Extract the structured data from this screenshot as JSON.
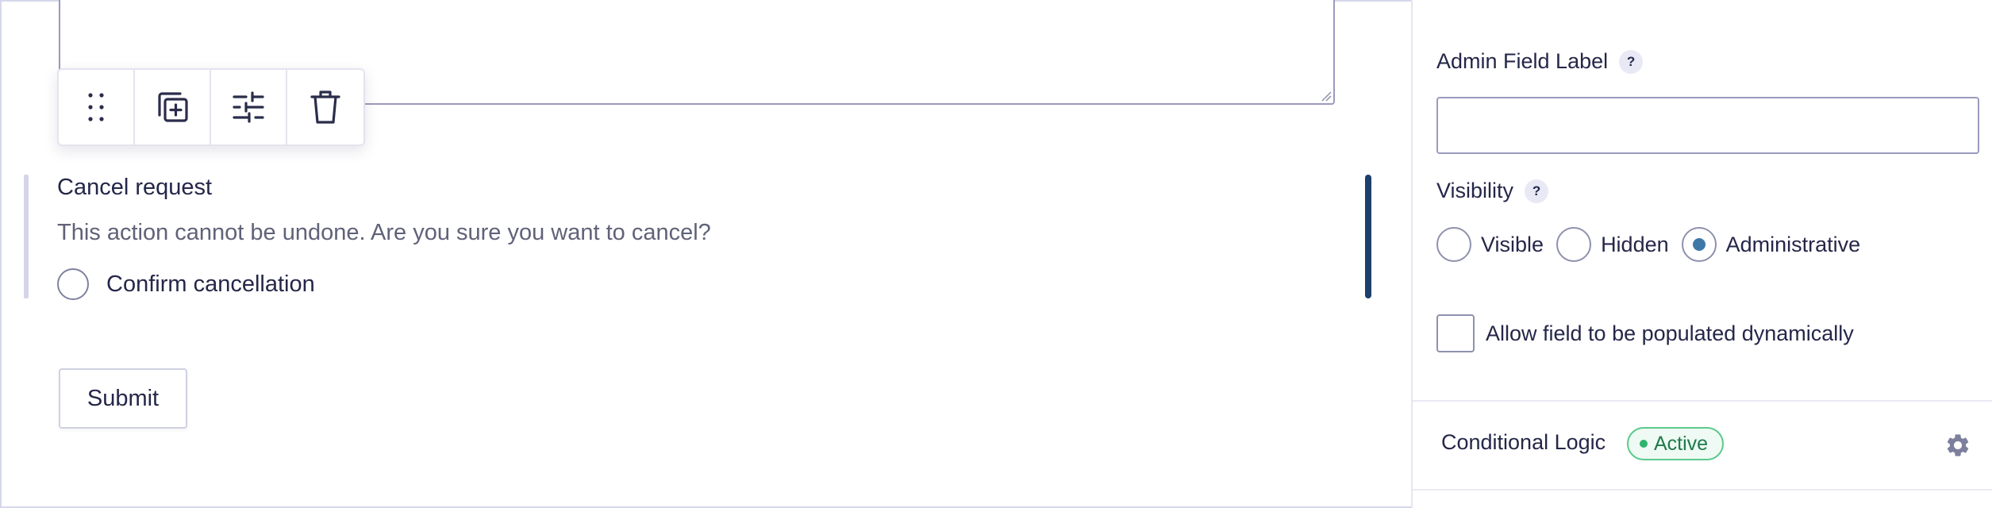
{
  "editor": {
    "toolbar": {
      "icons": [
        "drag-handle-icon",
        "duplicate-icon",
        "settings-sliders-icon",
        "trash-icon"
      ]
    },
    "field": {
      "label": "Cancel request",
      "description": "This action cannot be undone. Are you sure you want to cancel?",
      "choice_label": "Confirm cancellation"
    },
    "submit_label": "Submit"
  },
  "panel": {
    "admin_label": {
      "label": "Admin Field Label",
      "help": "?",
      "value": ""
    },
    "visibility": {
      "label": "Visibility",
      "help": "?",
      "options": [
        {
          "label": "Visible",
          "checked": false
        },
        {
          "label": "Hidden",
          "checked": false
        },
        {
          "label": "Administrative",
          "checked": true
        }
      ]
    },
    "dynamic_population": {
      "label": "Allow field to be populated dynamically",
      "checked": false
    },
    "conditional_logic": {
      "title": "Conditional Logic",
      "status": "Active",
      "status_color": "#2fb36d"
    }
  },
  "colors": {
    "accent_dark": "#1c3f6b",
    "radio_checked": "#3f78a7",
    "border": "#9b9abf",
    "text": "#242748"
  }
}
